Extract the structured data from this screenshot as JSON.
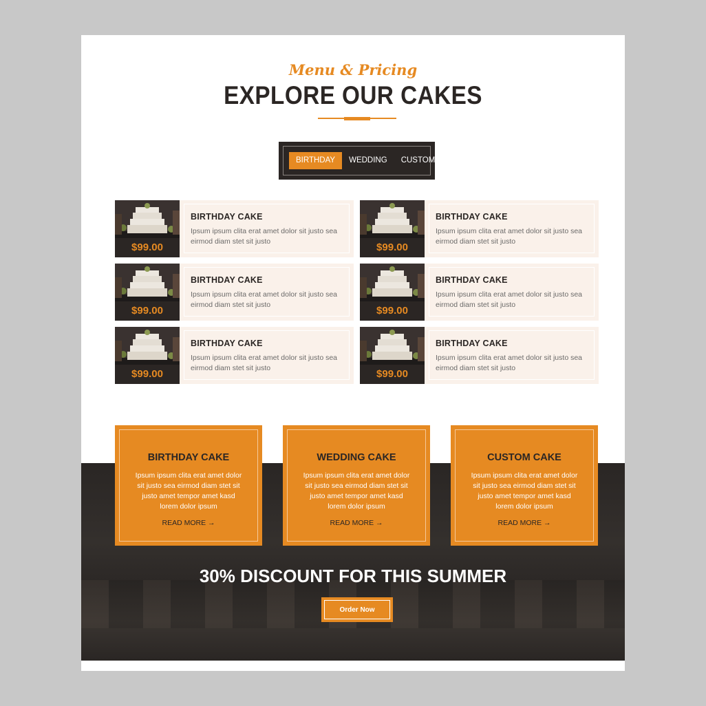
{
  "header": {
    "subtitle": "Menu & Pricing",
    "title": "EXPLORE OUR CAKES"
  },
  "tabs": [
    {
      "label": "BIRTHDAY",
      "active": true
    },
    {
      "label": "WEDDING",
      "active": false
    },
    {
      "label": "CUSTOM",
      "active": false
    }
  ],
  "menu_items": [
    {
      "name": "BIRTHDAY CAKE",
      "description": "Ipsum ipsum clita erat amet dolor sit justo sea eirmod diam stet sit justo",
      "price": "$99.00"
    },
    {
      "name": "BIRTHDAY CAKE",
      "description": "Ipsum ipsum clita erat amet dolor sit justo sea eirmod diam stet sit justo",
      "price": "$99.00"
    },
    {
      "name": "BIRTHDAY CAKE",
      "description": "Ipsum ipsum clita erat amet dolor sit justo sea eirmod diam stet sit justo",
      "price": "$99.00"
    },
    {
      "name": "BIRTHDAY CAKE",
      "description": "Ipsum ipsum clita erat amet dolor sit justo sea eirmod diam stet sit justo",
      "price": "$99.00"
    },
    {
      "name": "BIRTHDAY CAKE",
      "description": "Ipsum ipsum clita erat amet dolor sit justo sea eirmod diam stet sit justo",
      "price": "$99.00"
    },
    {
      "name": "BIRTHDAY CAKE",
      "description": "Ipsum ipsum clita erat amet dolor sit justo sea eirmod diam stet sit justo",
      "price": "$99.00"
    }
  ],
  "cards": [
    {
      "title": "BIRTHDAY CAKE",
      "description": "Ipsum ipsum clita erat amet dolor sit justo sea eirmod diam stet sit justo amet tempor amet kasd lorem dolor ipsum",
      "link": "READ MORE →"
    },
    {
      "title": "WEDDING CAKE",
      "description": "Ipsum ipsum clita erat amet dolor sit justo sea eirmod diam stet sit justo amet tempor amet kasd lorem dolor ipsum",
      "link": "READ MORE →"
    },
    {
      "title": "CUSTOM CAKE",
      "description": "Ipsum ipsum clita erat amet dolor sit justo sea eirmod diam stet sit justo amet tempor amet kasd lorem dolor ipsum",
      "link": "READ MORE →"
    }
  ],
  "promo": {
    "headline": "30% DISCOUNT FOR THIS SUMMER",
    "button_label": "Order Now"
  },
  "colors": {
    "accent": "#e68a22",
    "dark": "#2b2624",
    "item_bg": "#faf1ea",
    "frame_bg": "#c8c8c8"
  }
}
